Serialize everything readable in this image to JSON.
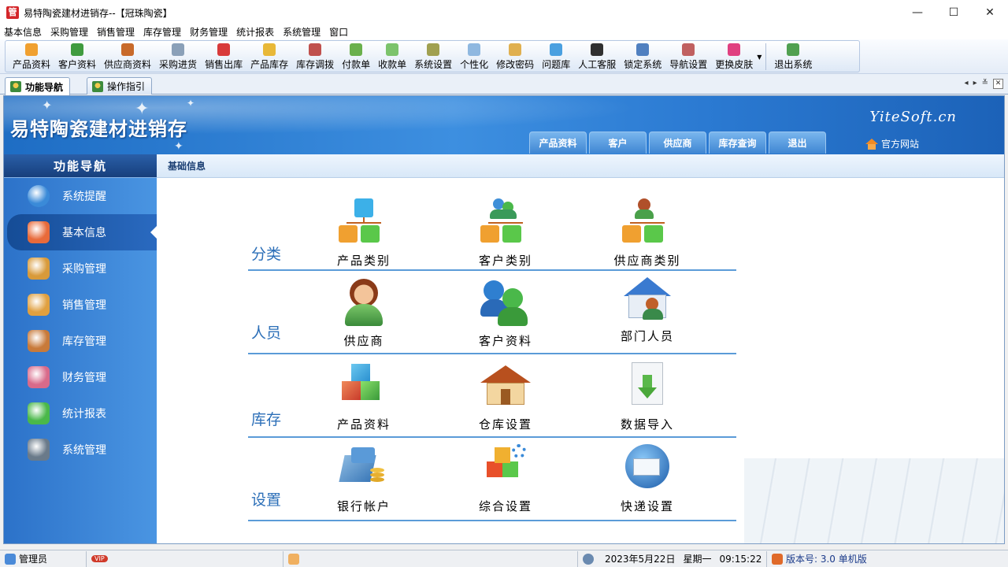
{
  "window": {
    "title": "易特陶瓷建材进销存--【冠珠陶瓷】",
    "app_icon_char": "管",
    "controls": {
      "minimize": "—",
      "maximize": "☐",
      "close": "✕"
    }
  },
  "menu": [
    "基本信息",
    "采购管理",
    "销售管理",
    "库存管理",
    "财务管理",
    "统计报表",
    "系统管理",
    "窗口"
  ],
  "toolbar": {
    "buttons": [
      {
        "label": "产品资料",
        "color": "#f0a030",
        "icon": "cube-icon"
      },
      {
        "label": "客户资料",
        "color": "#3f9b3f",
        "icon": "users-icon"
      },
      {
        "label": "供应商资料",
        "color": "#c86a2a",
        "icon": "supplier-icon"
      },
      {
        "label": "采购进货",
        "color": "#8aa0b8",
        "icon": "truck-icon"
      },
      {
        "label": "销售出库",
        "color": "#d83a3a",
        "icon": "basket-icon"
      },
      {
        "label": "产品库存",
        "color": "#e8b838",
        "icon": "stock-icon"
      },
      {
        "label": "库存调拨",
        "color": "#c0504d",
        "icon": "transfer-icon"
      },
      {
        "label": "付款单",
        "color": "#6ab04c",
        "icon": "pay-icon"
      },
      {
        "label": "收款单",
        "color": "#7cc36b",
        "icon": "receive-icon"
      },
      {
        "label": "系统设置",
        "color": "#a0a050",
        "icon": "settings-icon"
      },
      {
        "label": "个性化",
        "color": "#8fb8e0",
        "icon": "personalize-icon"
      },
      {
        "label": "修改密码",
        "color": "#e0b050",
        "icon": "password-icon"
      },
      {
        "label": "问题库",
        "color": "#4aa0e0",
        "icon": "faq-icon"
      },
      {
        "label": "人工客服",
        "color": "#303030",
        "icon": "qq-icon"
      },
      {
        "label": "锁定系统",
        "color": "#5080c0",
        "icon": "lock-icon"
      },
      {
        "label": "导航设置",
        "color": "#c06060",
        "icon": "nav-settings-icon"
      },
      {
        "label": "更换皮肤",
        "color": "#e04080",
        "icon": "skin-icon"
      },
      {
        "label": "退出系统",
        "color": "#50a050",
        "icon": "exit-icon"
      }
    ]
  },
  "tabs": [
    {
      "label": "功能导航",
      "active": true
    },
    {
      "label": "操作指引",
      "active": false
    }
  ],
  "tab_controls": {
    "prev": "◂",
    "next": "▸",
    "menu": "≚",
    "close": "✕"
  },
  "banner": {
    "app_name": "易特陶瓷建材进销存",
    "brand": "YiteSoft.cn",
    "home_link": "官方网站",
    "nav_tabs": [
      "产品资料",
      "客户",
      "供应商",
      "库存查询",
      "退出"
    ]
  },
  "leftnav": {
    "title": "功能导航",
    "items": [
      {
        "label": "系统提醒",
        "icon": "info-icon",
        "active": false
      },
      {
        "label": "基本信息",
        "icon": "cubes-icon",
        "active": true
      },
      {
        "label": "采购管理",
        "icon": "purchase-box-icon",
        "active": false
      },
      {
        "label": "销售管理",
        "icon": "sales-box-icon",
        "active": false
      },
      {
        "label": "库存管理",
        "icon": "warehouse-icon",
        "active": false
      },
      {
        "label": "财务管理",
        "icon": "finance-icon",
        "active": false
      },
      {
        "label": "统计报表",
        "icon": "chart-icon",
        "active": false
      },
      {
        "label": "系统管理",
        "icon": "tools-icon",
        "active": false
      }
    ]
  },
  "content": {
    "breadcrumb": "基础信息",
    "sections": [
      {
        "label": "分类",
        "tiles": [
          "产品类别",
          "客户类别",
          "供应商类别"
        ]
      },
      {
        "label": "人员",
        "tiles": [
          "供应商",
          "客户资料",
          "部门人员"
        ]
      },
      {
        "label": "库存",
        "tiles": [
          "产品资料",
          "仓库设置",
          "数据导入"
        ]
      },
      {
        "label": "设置",
        "tiles": [
          "银行帐户",
          "综合设置",
          "快递设置"
        ]
      }
    ]
  },
  "status": {
    "user": "管理员",
    "vip": "VIP",
    "date": "2023年5月22日",
    "weekday": "星期一",
    "time": "09:15:22",
    "version": "版本号: 3.0 单机版"
  }
}
